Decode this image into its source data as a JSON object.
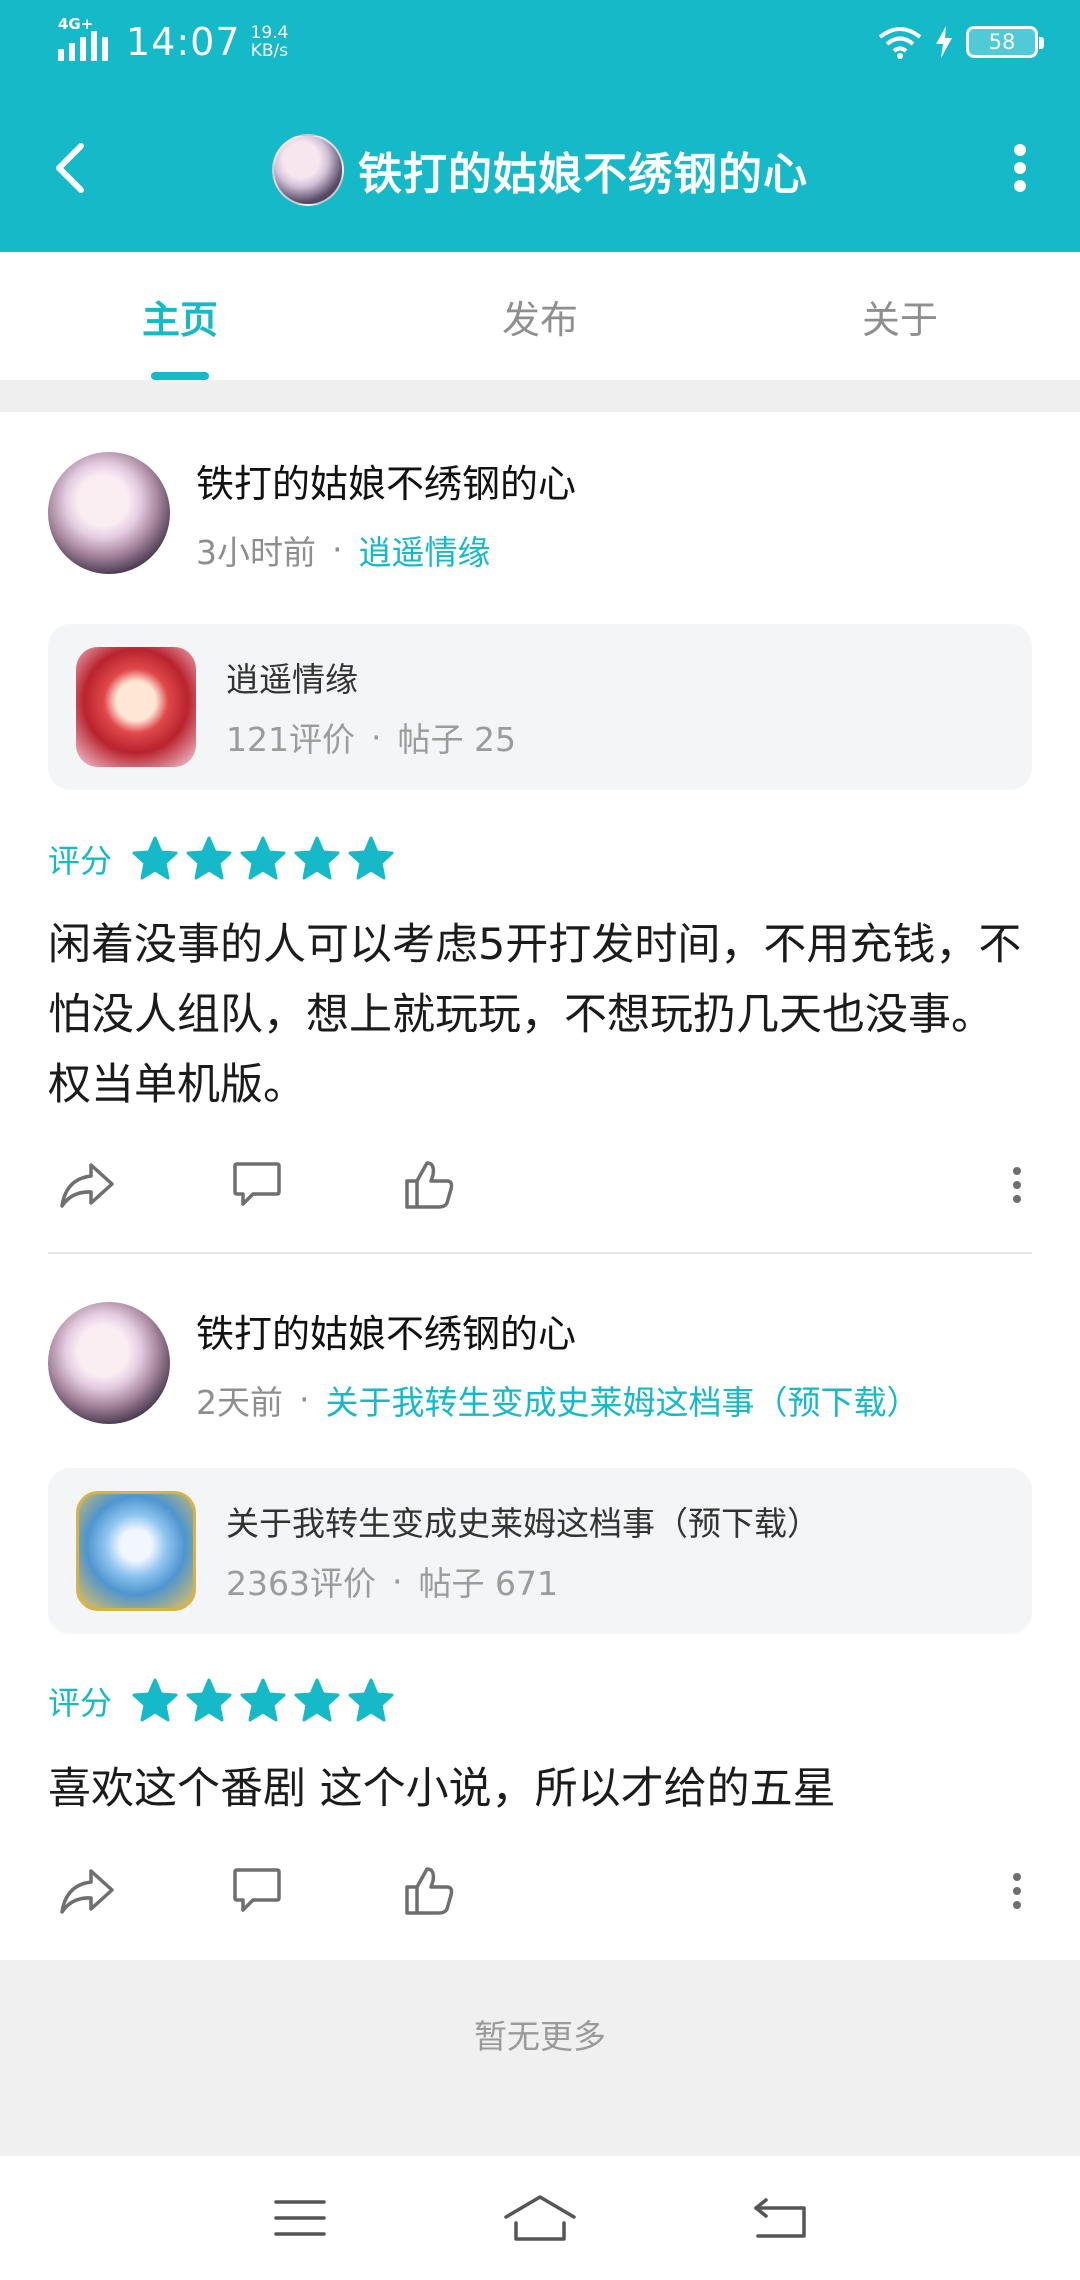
{
  "status_bar": {
    "network": "4G+",
    "time": "14:07",
    "speed_value": "19.4",
    "speed_unit": "KB/s",
    "battery": "58"
  },
  "header": {
    "title": "铁打的姑娘不绣钢的心",
    "back_icon": "back-arrow-icon",
    "more_icon": "more-vertical-icon"
  },
  "tabs": [
    {
      "label": "主页",
      "active": true
    },
    {
      "label": "发布",
      "active": false
    },
    {
      "label": "关于",
      "active": false
    }
  ],
  "posts": [
    {
      "author": "铁打的姑娘不绣钢的心",
      "time": "3小时前",
      "separator": "·",
      "game": "逍遥情缘",
      "card": {
        "name": "逍遥情缘",
        "reviews": "121评价",
        "posts": "帖子 25"
      },
      "rating_label": "评分",
      "rating": 5,
      "text": "闲着没事的人可以考虑5开打发时间，不用充钱，不怕没人组队，想上就玩玩，不想玩扔几天也没事。权当单机版。"
    },
    {
      "author": "铁打的姑娘不绣钢的心",
      "time": "2天前",
      "separator": "·",
      "game": "关于我转生变成史莱姆这档事（预下载）",
      "card": {
        "name": "关于我转生变成史莱姆这档事（预下载）",
        "reviews": "2363评价",
        "posts": "帖子 671"
      },
      "rating_label": "评分",
      "rating": 5,
      "text": "喜欢这个番剧 这个小说，所以才给的五星"
    }
  ],
  "footer": {
    "no_more": "暂无更多"
  },
  "colors": {
    "accent": "#16b9c8",
    "background": "#ffffff",
    "muted": "#8e8e8e"
  }
}
